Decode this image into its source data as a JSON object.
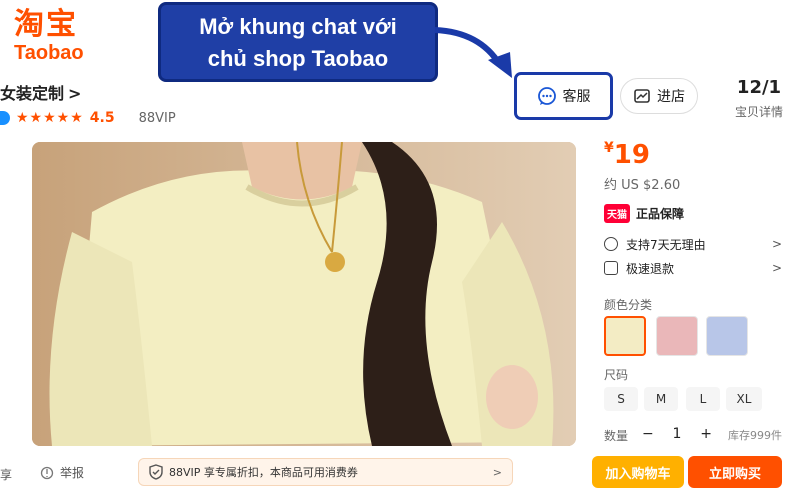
{
  "logo": {
    "cn": "淘宝",
    "en": "Taobao"
  },
  "callout": {
    "line1": "Mở khung chat với",
    "line2": "chủ shop Taobao"
  },
  "shop": {
    "name": "女装定制",
    "chevron": ">",
    "stars": "★★★★★",
    "rating": "4.5",
    "vip": "88VIP"
  },
  "header": {
    "service_label": "客服",
    "store_label": "进店",
    "date": "12/1",
    "date_sub": "宝贝详情"
  },
  "product": {
    "price_currency": "¥",
    "price": "19",
    "price_usd": "约 US $2.60",
    "tmall_badge": "天猫",
    "guarantee": "正品保障",
    "services": [
      {
        "label": "支持7天无理由",
        "chevron": ">"
      },
      {
        "label": "极速退款",
        "chevron": ">"
      }
    ],
    "color_label": "颜色分类",
    "colors": [
      {
        "name": "yellow",
        "hex": "#f3ecc4"
      },
      {
        "name": "pink",
        "hex": "#eab7b9"
      },
      {
        "name": "blue",
        "hex": "#b8c6e8"
      }
    ],
    "size_label": "尺码",
    "sizes": [
      "S",
      "M",
      "L",
      "XL"
    ],
    "qty_label": "数量",
    "qty_minus": "−",
    "qty_value": "1",
    "qty_plus": "+",
    "stock": "库存999件",
    "add_to_cart": "加入购物车",
    "buy_now": "立即购买"
  },
  "bottom": {
    "share_tail": "享",
    "report": "举报",
    "vip_banner": "88VIP 享专属折扣，本商品可用消费券",
    "vip_chevron": ">"
  },
  "colors": {
    "accent": "#ff5000",
    "callout": "#1f3fa6",
    "cart": "#ffb000"
  }
}
